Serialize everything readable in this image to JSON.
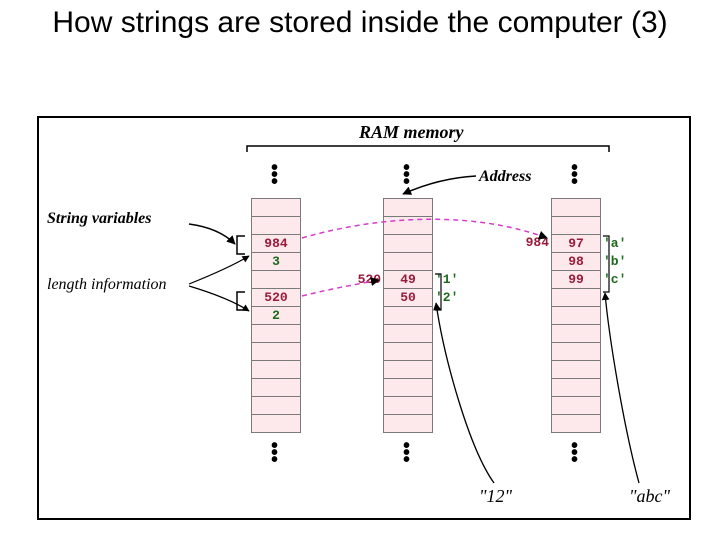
{
  "title": "How strings are stored inside the computer (3)",
  "labels": {
    "ram": "RAM memory",
    "address": "Address",
    "stringvars": "String variables",
    "lengthinfo": "length information"
  },
  "col1": {
    "cells": [
      "",
      "",
      "984",
      "3",
      "",
      "520",
      "2",
      "",
      "",
      "",
      "",
      "",
      ""
    ]
  },
  "col2": {
    "addr": "520",
    "cells": [
      "",
      "",
      "",
      "",
      "49",
      "50",
      "",
      "",
      "",
      "",
      "",
      "",
      ""
    ],
    "annot": [
      "",
      "",
      "",
      "",
      "'1'",
      "'2'",
      "",
      "",
      "",
      "",
      "",
      "",
      ""
    ]
  },
  "col3": {
    "addr": "984",
    "cells": [
      "",
      "",
      "97",
      "98",
      "99",
      "",
      "",
      "",
      "",
      "",
      "",
      "",
      ""
    ],
    "annot": [
      "",
      "",
      "'a'",
      "'b'",
      "'c'",
      "",
      "",
      "",
      "",
      "",
      "",
      "",
      ""
    ]
  },
  "strlits": {
    "l1": "\"12\"",
    "l2": "\"abc\""
  }
}
